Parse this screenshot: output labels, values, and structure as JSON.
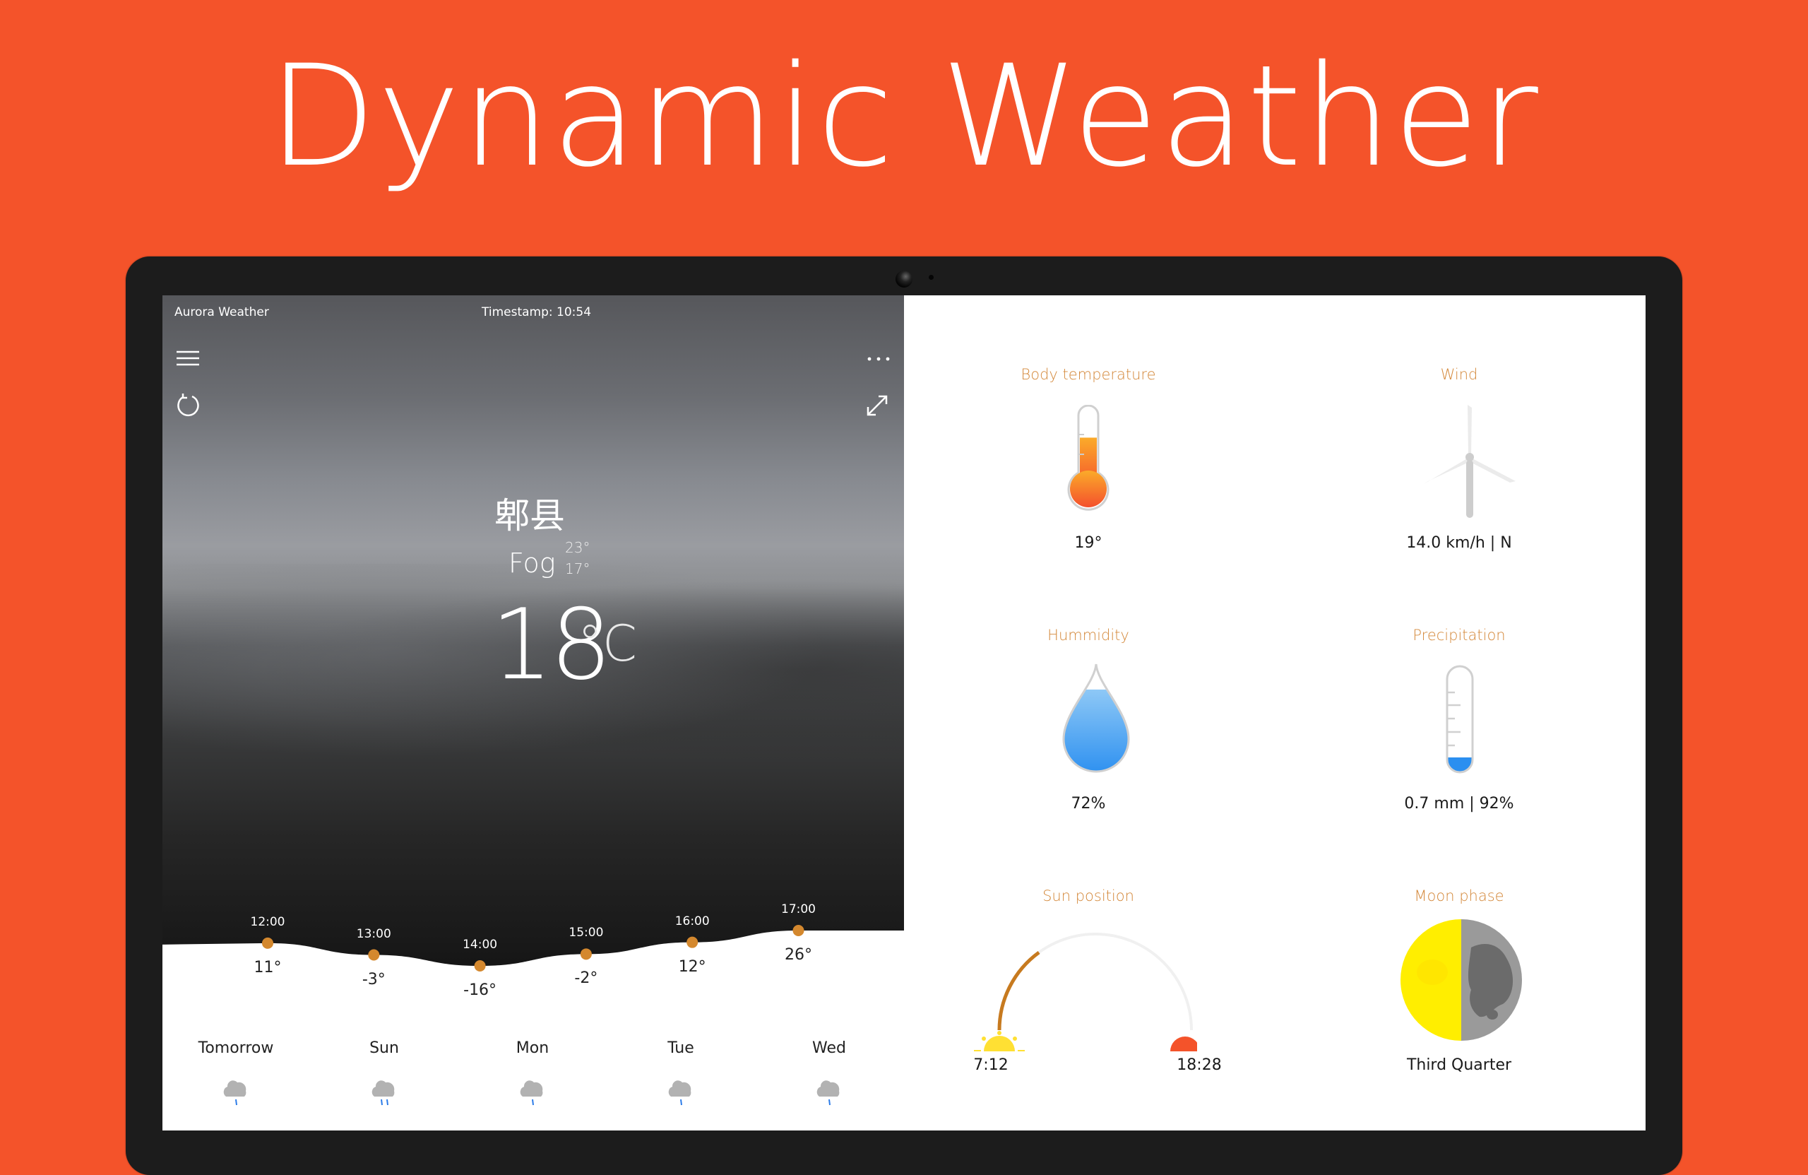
{
  "hero": {
    "title": "Dynamic Weather"
  },
  "colors": {
    "background": "#f4532a",
    "accent": "#d4883a",
    "dot": "#d4882e",
    "humidity_blue": "#4aa3f0",
    "sun_yellow": "#ffe033",
    "sunset_red": "#f4532a",
    "moon_yellow": "#ffee00"
  },
  "app": {
    "name": "Aurora Weather",
    "timestamp": "Timestamp: 10:54",
    "icons": {
      "menu": "hamburger-icon",
      "more": "more-icon",
      "refresh": "refresh-icon",
      "expand": "expand-icon"
    }
  },
  "current": {
    "city": "郫县",
    "condition": "Fog",
    "high": "23°",
    "low": "17°",
    "temperature": "18",
    "unit": "°C"
  },
  "hourly": [
    {
      "time": "12:00",
      "temp": "11°",
      "value": 11
    },
    {
      "time": "13:00",
      "temp": "-3°",
      "value": -3
    },
    {
      "time": "14:00",
      "temp": "-16°",
      "value": -16
    },
    {
      "time": "15:00",
      "temp": "-2°",
      "value": -2
    },
    {
      "time": "16:00",
      "temp": "12°",
      "value": 12
    },
    {
      "time": "17:00",
      "temp": "26°",
      "value": 26
    }
  ],
  "daily": [
    {
      "day": "Tomorrow",
      "icon": "rain-cloud-icon",
      "drops": 1
    },
    {
      "day": "Sun",
      "icon": "rain-cloud-icon",
      "drops": 2
    },
    {
      "day": "Mon",
      "icon": "rain-cloud-icon",
      "drops": 1
    },
    {
      "day": "Tue",
      "icon": "rain-cloud-icon",
      "drops": 1
    },
    {
      "day": "Wed",
      "icon": "rain-cloud-icon",
      "drops": 1
    }
  ],
  "details": {
    "body_temperature": {
      "title": "Body temperature",
      "value": "19°",
      "fill": 0.6
    },
    "wind": {
      "title": "Wind",
      "value": "14.0 km/h | N"
    },
    "humidity": {
      "title": "Hummidity",
      "value": "72%",
      "fill": 0.72
    },
    "precipitation": {
      "title": "Precipitation",
      "value": "0.7 mm | 92%",
      "fill": 0.07
    },
    "sun_position": {
      "title": "Sun position",
      "sunrise": "7:12",
      "sunset": "18:28",
      "progress": 0.3
    },
    "moon_phase": {
      "title": "Moon phase",
      "value": "Third Quarter"
    }
  }
}
